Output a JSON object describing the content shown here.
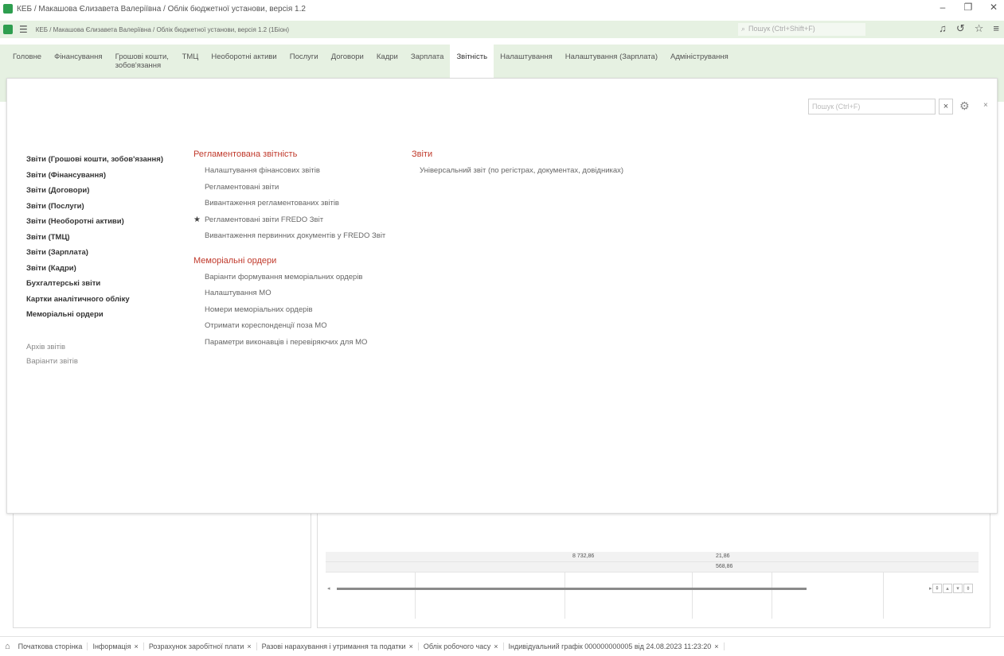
{
  "titlebar": {
    "title": "КЕБ / Макашова Єлизавета Валеріївна / Облік бюджетної установи, версія 1.2",
    "controls": [
      "–",
      "❐",
      "✕"
    ]
  },
  "addressbar": {
    "text": "КЕБ / Макашова Єлизавета Валеріївна / Облік бюджетної установи, версія 1.2 (1Біон)",
    "search_placeholder": "Пошук (Ctrl+Shift+F)",
    "icons": [
      "bell-icon",
      "history-icon",
      "star-icon",
      "menu-icon"
    ]
  },
  "sections": [
    "Головне",
    "Фінансування",
    "Грошові кошти, зобов'язання",
    "ТМЦ",
    "Необоротні активи",
    "Послуги",
    "Договори",
    "Кадри",
    "Зарплата",
    "Звітність",
    "Налаштування",
    "Налаштування (Зарплата)",
    "Адміністрування"
  ],
  "active_section": "Звітність",
  "panel": {
    "search_placeholder": "Пошук (Ctrl+F)",
    "clear_label": "×",
    "left_nav": [
      "Звіти (Грошові кошти, зобов'язання)",
      "Звіти (Фінансування)",
      "Звіти (Договори)",
      "Звіти (Послуги)",
      "Звіти (Необоротні активи)",
      "Звіти (ТМЦ)",
      "Звіти (Зарплата)",
      "Звіти (Кадри)",
      "Бухгалтерські звіти",
      "Картки аналітичного обліку",
      "Меморіальні ордери"
    ],
    "left_sub": [
      "Архів звітів",
      "Варіанти звітів"
    ],
    "reglament": {
      "title": "Регламентована звітність",
      "items": [
        "Налаштування фінансових звітів",
        "Регламентовані звіти",
        "Вивантаження регламентованих звітів",
        "Регламентовані звіти FREDO Звіт",
        "Вивантаження первинних документів у FREDO Звіт"
      ],
      "starred_index": 3
    },
    "memorial": {
      "title": "Меморіальні ордери",
      "items": [
        "Варіанти формування меморіальних ордерів",
        "Налаштування МО",
        "Номери меморіальних ордерів",
        "Отримати кореспонденції поза МО",
        "Параметри виконавців і перевіряючих для МО"
      ]
    },
    "reports": {
      "title": "Звіти",
      "items": [
        "Універсальний звіт (по регістрах, документах, довідниках)"
      ]
    }
  },
  "background_grid": {
    "row1": [
      "8 732,86",
      "21,86"
    ],
    "row2": [
      "568,86"
    ]
  },
  "bottom_tabs": [
    "Початкова сторінка",
    "Інформація",
    "Розрахунок заробітної плати",
    "Разові нарахування і утримання та податки",
    "Облік робочого часу",
    "Індивідуальний графік 000000000005 від 24.08.2023 11:23:20"
  ],
  "colors": {
    "accent_green": "#2e9e4f",
    "section_bg": "#e6f1e2",
    "group_title": "#c0392b"
  }
}
